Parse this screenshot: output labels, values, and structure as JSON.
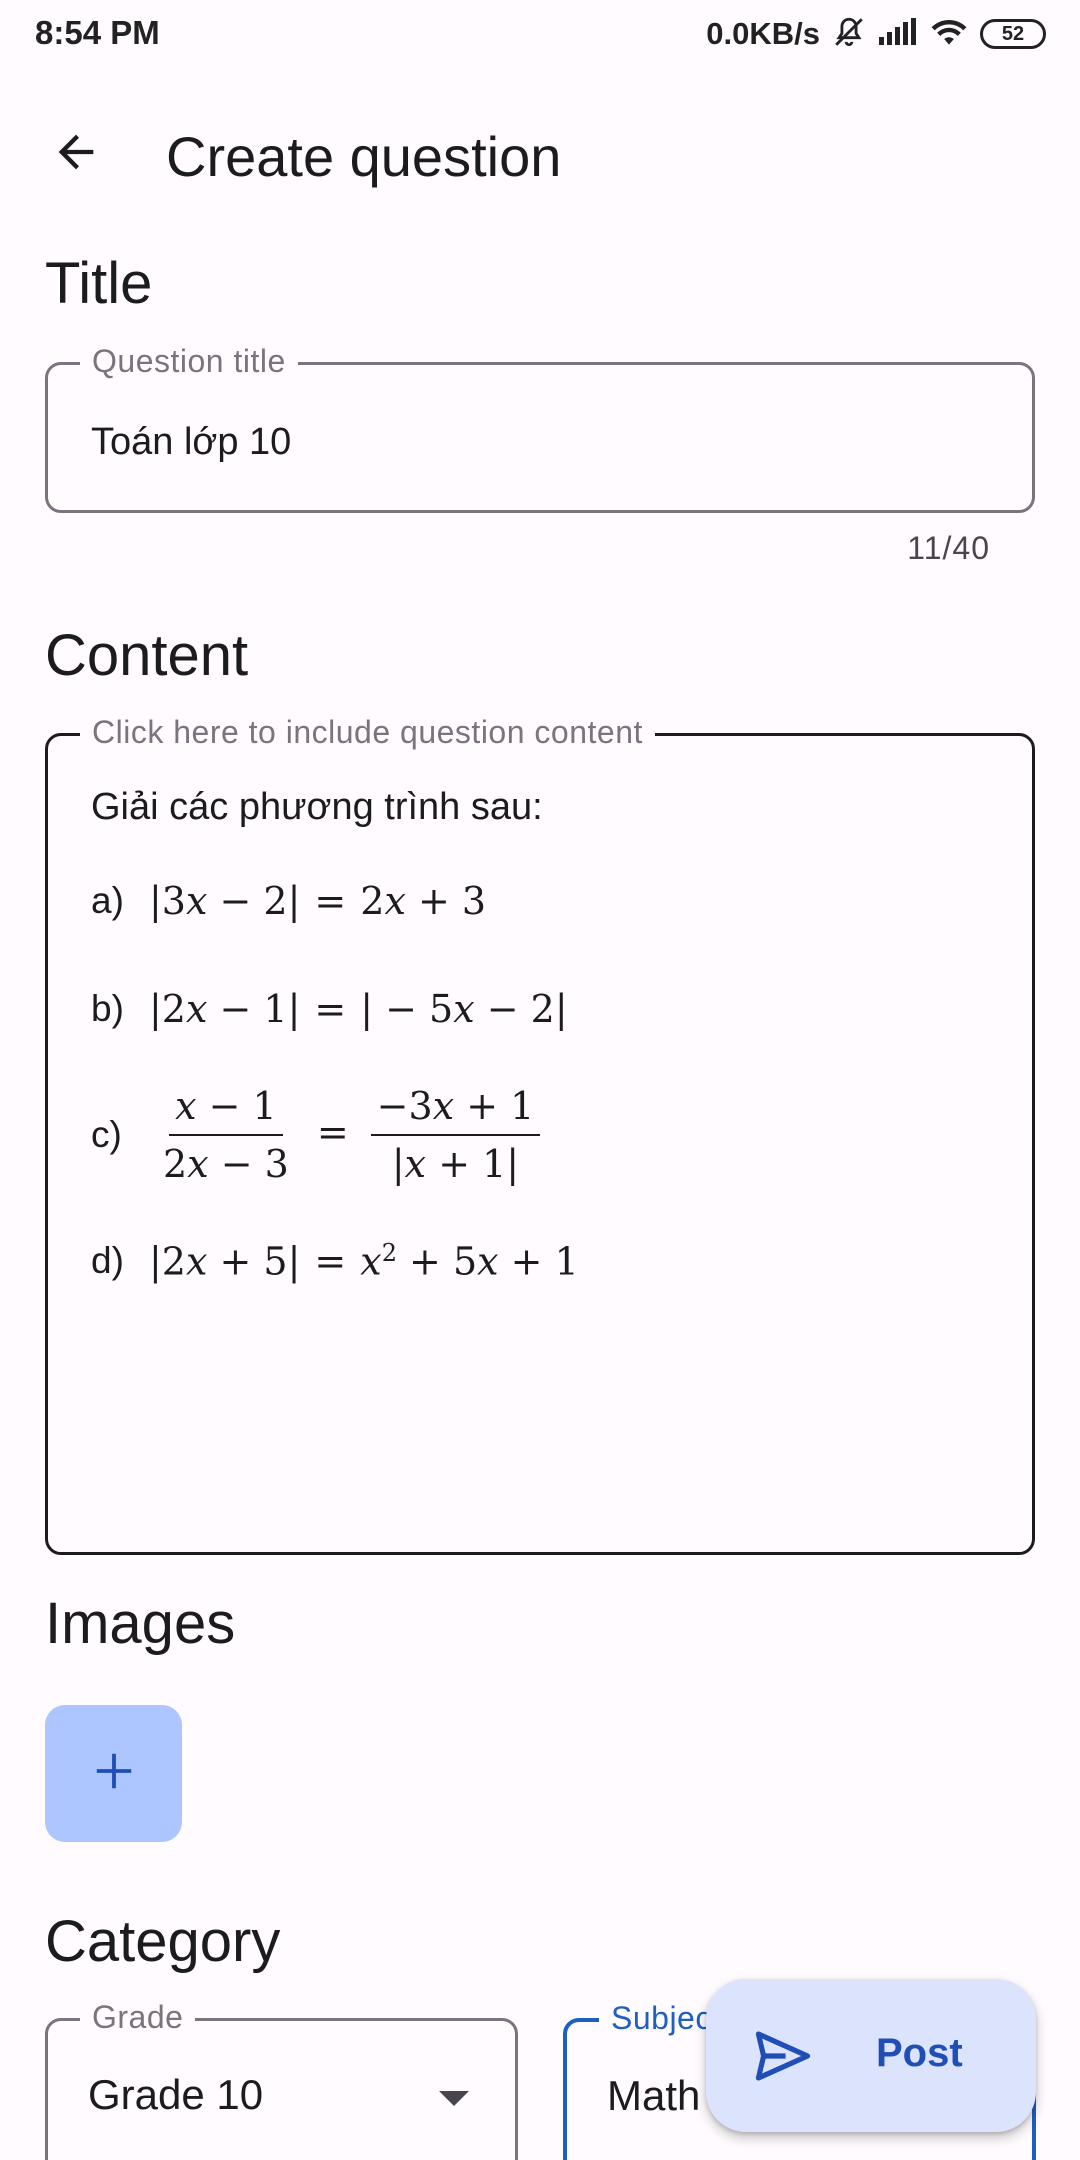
{
  "status_bar": {
    "time": "8:54 PM",
    "net_speed": "0.0KB/s",
    "battery": "52",
    "icons": [
      "mute-icon",
      "signal-icon",
      "wifi-icon",
      "battery-icon"
    ]
  },
  "app_bar": {
    "title": "Create question",
    "back_icon": "arrow-back-icon"
  },
  "title_section": {
    "heading": "Title",
    "field_label": "Question title",
    "value": "Toán lớp 10",
    "counter": "11/40"
  },
  "content_section": {
    "heading": "Content",
    "field_label": "Click here to include question content",
    "intro": "Giải các phương trình sau:",
    "items": [
      {
        "label": "a)",
        "equation": "|3x − 2| = 2x + 3"
      },
      {
        "label": "b)",
        "equation": "|2x − 1| = | − 5x − 2|"
      },
      {
        "label": "c)",
        "equation": "(x − 1)/(2x − 3) = (−3x + 1)/|x + 1|"
      },
      {
        "label": "d)",
        "equation": "|2x + 5| = x² + 5x + 1"
      }
    ]
  },
  "images_section": {
    "heading": "Images",
    "add_icon": "plus-icon"
  },
  "category_section": {
    "heading": "Category",
    "grade_label": "Grade",
    "grade_value": "Grade 10",
    "subject_label": "Subject",
    "subject_value": "Math"
  },
  "fab": {
    "label": "Post",
    "icon": "send-icon"
  },
  "colors": {
    "background": "#fffbfe",
    "accent": "#1f5fc4",
    "fab_bg": "#dbe3fd",
    "add_button_bg": "#adc6ff"
  }
}
